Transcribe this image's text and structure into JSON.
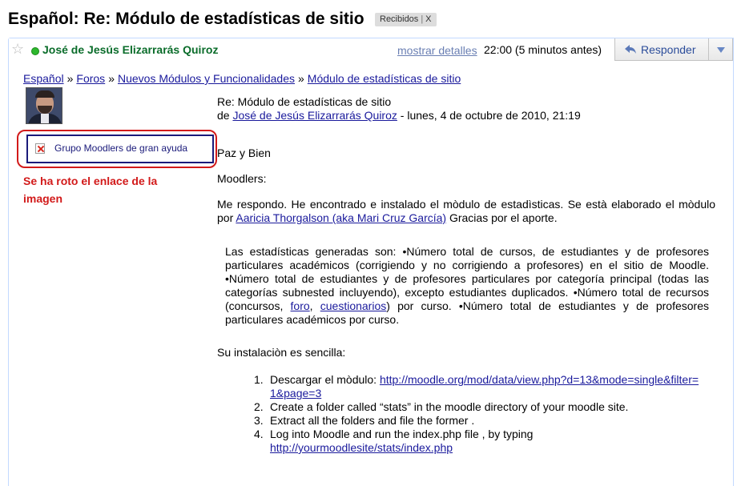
{
  "subject": "Español: Re: Módulo de estadísticas de sitio",
  "label_chip": {
    "label": "Recibidos",
    "remove": "X"
  },
  "header": {
    "sender": "José de Jesús Elizarrarás Quiroz",
    "details_link": "mostrar detalles",
    "time": "22:00 (5 minutos antes)",
    "reply_label": "Responder"
  },
  "breadcrumb": [
    "Español",
    "Foros",
    "Nuevos Módulos y Funcionalidades",
    "Módulo de estadísticas de sitio"
  ],
  "breadcrumb_sep": "»",
  "post": {
    "title": "Re: Módulo de estadísticas de sitio",
    "by": "de",
    "author": "José de Jesús Elizarrarás Quiroz",
    "date": "- lunes, 4 de octubre de 2010, 21:19"
  },
  "broken_image": {
    "alt": "Grupo Moodlers de gran ayuda",
    "note": "Se ha roto el enlace de la imagen"
  },
  "body": {
    "greeting": "Paz y Bien",
    "moodlers": "Moodlers:",
    "reply_before": "Me respondo. He encontrado e instalado el mòdulo de estadìsticas. Se està elaborado el mòdulo por ",
    "reply_link": "Aaricia Thorgalson (aka Mari Cruz García)",
    "reply_after": " Gracias por el aporte.",
    "quote_a": "Las estadísticas generadas son: •Número total de cursos, de estudiantes y de profesores particulares académicos (corrigiendo y no corrigiendo a profesores) en el sitio de Moodle. •Número total de estudiantes y de profesores particulares por categoría principal (todas las categorías subnested incluyendo), excepto estudiantes duplicados. •Número total de recursos (concursos, ",
    "quote_link1": "foro",
    "quote_comma": ", ",
    "quote_link2": "cuestionarios",
    "quote_b": ") por curso. •Número total de estudiantes y de profesores particulares académicos por curso.",
    "install_intro": "Su instalaciòn es sencilla:",
    "steps": [
      {
        "num": "1.",
        "text": "Descargar el mòdulo: ",
        "link": "http://moodle.org/mod/data/view.php?d=13&mode=single&filter=1&page=3"
      },
      {
        "num": "2.",
        "text": "Create a folder called “stats” in the moodle directory of your moodle site.",
        "link": ""
      },
      {
        "num": "3.",
        "text": "Extract all the folders and file the former .",
        "link": ""
      },
      {
        "num": "4.",
        "text": "Log into Moodle and run the index.php file , by typing ",
        "link": "http://yourmoodlesite/stats/index.php"
      }
    ]
  },
  "colors": {
    "sender": "#0a6c2a",
    "link": "#1a1a9c",
    "annotation": "#d21a1a",
    "online": "#2eb82e"
  }
}
